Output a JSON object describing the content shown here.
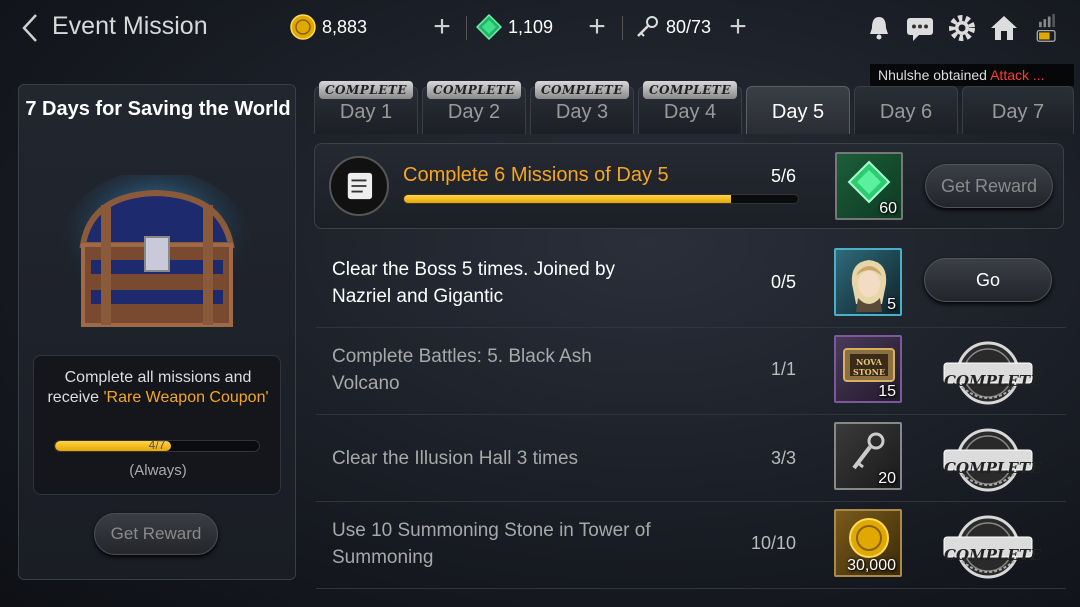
{
  "header": {
    "title": "Event Mission",
    "gold": "8,883",
    "gems": "1,109",
    "stamina": "80/73"
  },
  "notice": {
    "prefix": "Nhulshe obtained ",
    "highlight": "Attack ..."
  },
  "left_panel": {
    "title": "7 Days for Saving the World",
    "desc_line1": "Complete all missions and",
    "desc_line2_prefix": "receive ",
    "desc_line2_highlight": "'Rare Weapon Coupon'",
    "progress_text": "4/7",
    "progress_fraction": 0.57,
    "period": "(Always)",
    "button": "Get Reward"
  },
  "tabs": [
    {
      "label": "Day 1",
      "badge": "COMPLETE"
    },
    {
      "label": "Day 2",
      "badge": "COMPLETE"
    },
    {
      "label": "Day 3",
      "badge": "COMPLETE"
    },
    {
      "label": "Day 4",
      "badge": "COMPLETE"
    },
    {
      "label": "Day 5",
      "badge": ""
    },
    {
      "label": "Day 6",
      "badge": ""
    },
    {
      "label": "Day 7",
      "badge": ""
    }
  ],
  "main_mission": {
    "title": "Complete 6 Missions of Day 5",
    "count": "5/6",
    "progress_fraction": 0.83,
    "reward_qty": "60",
    "button": "Get Reward"
  },
  "missions": [
    {
      "line1": "Clear the Boss 5 times. Joined by",
      "line2": "Nazriel and Gigantic",
      "count": "0/5",
      "reward_qty": "5",
      "action": "Go"
    },
    {
      "line1": "Complete Battles: 5. Black Ash",
      "line2": "Volcano",
      "count": "1/1",
      "reward_qty": "15",
      "action": "COMPLETE"
    },
    {
      "line1": "Clear the Illusion Hall 3 times",
      "line2": "",
      "count": "3/3",
      "reward_qty": "20",
      "action": "COMPLETE"
    },
    {
      "line1": "Use 10 Summoning Stone in Tower of",
      "line2": "Summoning",
      "count": "10/10",
      "reward_qty": "30,000",
      "action": "COMPLETE"
    }
  ],
  "nova_text": "NOVA STONE",
  "colors": {
    "accent_orange": "#f5a623",
    "progress_yellow": "#ffc61a",
    "gem_green": "#2ecc71"
  }
}
